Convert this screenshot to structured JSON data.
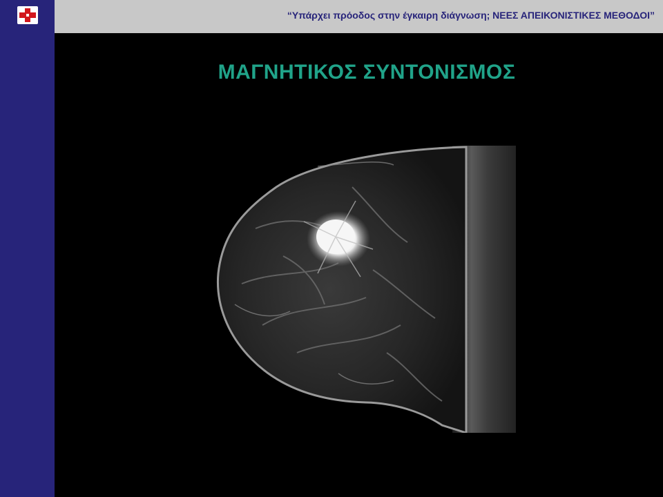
{
  "header": {
    "text": "“Υπάρχει πρόοδος στην έγκαιρη διάγνωση; ΝΕΕΣ ΑΠΕΙΚΟΝΙΣΤΙΚΕΣ ΜΕΘΟΔΟΙ”"
  },
  "slide": {
    "title": "ΜΑΓΝΗΤΙΚΟΣ ΣΥΝΤΟΝΙΣΜΟΣ"
  },
  "colors": {
    "sidebar": "#27247a",
    "header_bg": "#c8c8c8",
    "header_text": "#27247a",
    "title": "#20a389",
    "background": "#000000"
  },
  "icons": {
    "logo": "red-cross-logo-icon"
  },
  "image": {
    "subject": "breast-mri-scan"
  }
}
